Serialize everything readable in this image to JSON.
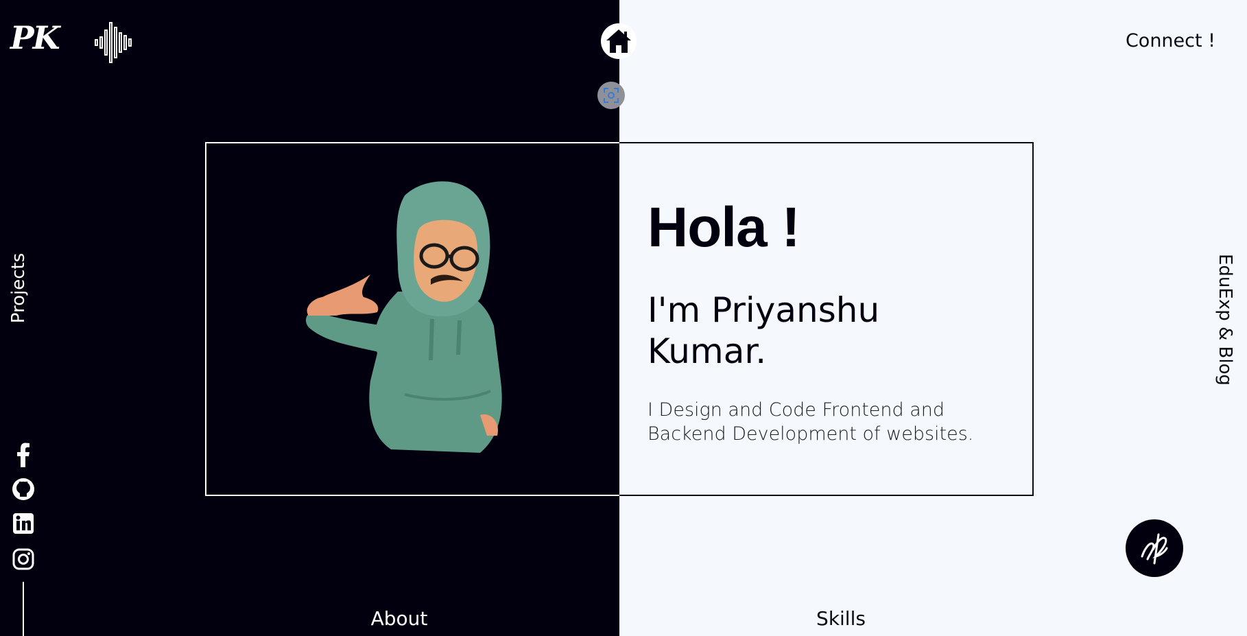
{
  "header": {
    "logo_text": "PK",
    "sound_icon": "sound-wave-icon",
    "home_icon": "home-icon",
    "connect_label": "Connect !"
  },
  "side_nav": {
    "left_label": "Projects",
    "right_label": "EduExp & Blog"
  },
  "hero": {
    "greeting": "Hola !",
    "name": "I'm Priyanshu Kumar.",
    "tagline": "I Design and Code Frontend and Backend Development of websites.",
    "avatar_icon": "cartoon-avatar-icon"
  },
  "social_links": [
    {
      "icon": "facebook-icon"
    },
    {
      "icon": "github-icon"
    },
    {
      "icon": "linkedin-icon"
    },
    {
      "icon": "instagram-icon"
    }
  ],
  "bottom_nav": {
    "about_label": "About",
    "skills_label": "Skills"
  },
  "colors": {
    "dark": "#02000f",
    "light": "#f5f9fd",
    "hoodie": "#5e9a86"
  }
}
